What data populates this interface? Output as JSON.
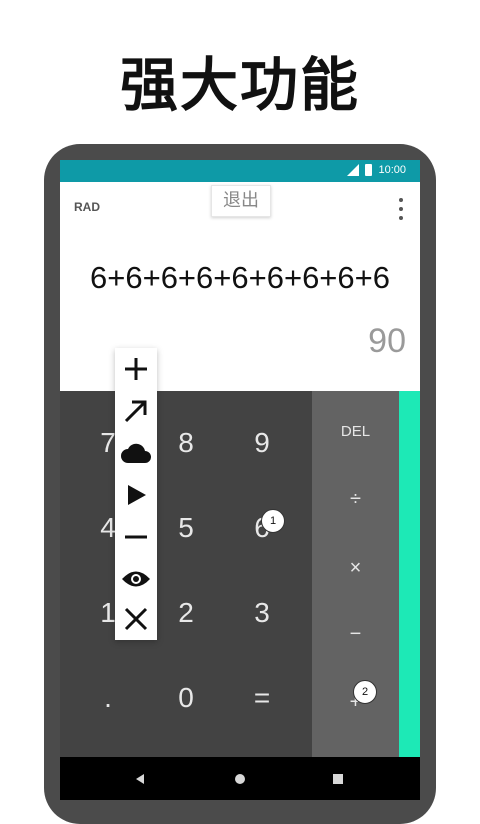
{
  "headline": "强大功能",
  "status": {
    "time": "10:00"
  },
  "display": {
    "angle_mode": "RAD",
    "exit_label": "退出",
    "formula": "6+6+6+6+6+6+6+6+6",
    "result": "90"
  },
  "keys": {
    "k7": "7",
    "k8": "8",
    "k9": "9",
    "k4": "4",
    "k5": "5",
    "k6": "6",
    "k1": "1",
    "k2": "2",
    "k3": "3",
    "kdot": ".",
    "k0": "0",
    "keq": "="
  },
  "ops": {
    "del": "DEL",
    "div": "÷",
    "mul": "×",
    "sub": "−",
    "add": "+"
  },
  "badges": {
    "one": "1",
    "two": "2"
  },
  "colors": {
    "status_bar": "#0e9aa7",
    "accent": "#1de9b6",
    "keypad": "#434343",
    "ops_panel": "#636363"
  },
  "icons": [
    "plus-icon",
    "arrow-up-right-icon",
    "cloud-icon",
    "play-icon",
    "minus-icon",
    "eye-icon",
    "close-icon",
    "back-icon",
    "home-icon",
    "recents-icon"
  ]
}
